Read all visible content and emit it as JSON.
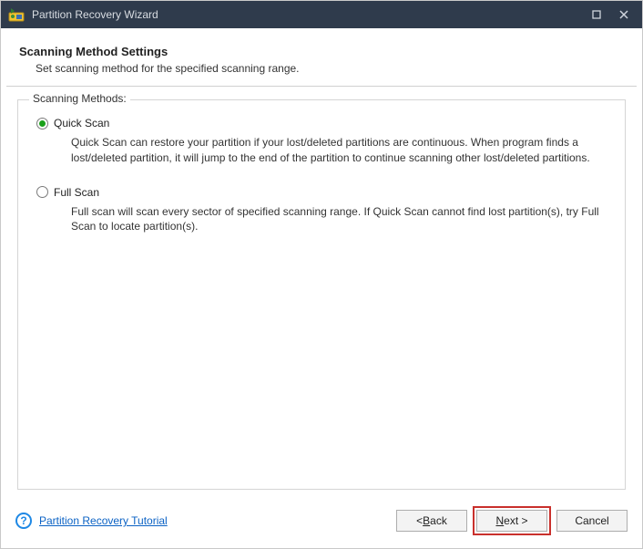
{
  "window": {
    "title": "Partition Recovery Wizard"
  },
  "header": {
    "title": "Scanning Method Settings",
    "subtitle": "Set scanning method for the specified scanning range."
  },
  "group": {
    "legend": "Scanning Methods:",
    "options": [
      {
        "id": "quick",
        "label": "Quick Scan",
        "selected": true,
        "description": "Quick Scan can restore your partition if your lost/deleted partitions are continuous. When program finds a lost/deleted partition, it will jump to the end of the partition to continue scanning other lost/deleted partitions."
      },
      {
        "id": "full",
        "label": "Full Scan",
        "selected": false,
        "description": "Full scan will scan every sector of specified scanning range. If Quick Scan cannot find lost partition(s), try Full Scan to locate partition(s)."
      }
    ]
  },
  "footer": {
    "help_link": "Partition Recovery Tutorial",
    "back_prefix": "< ",
    "back_mn": "B",
    "back_suffix": "ack",
    "next_mn": "N",
    "next_suffix": "ext >",
    "cancel": "Cancel"
  },
  "icons": {
    "help_glyph": "?"
  }
}
